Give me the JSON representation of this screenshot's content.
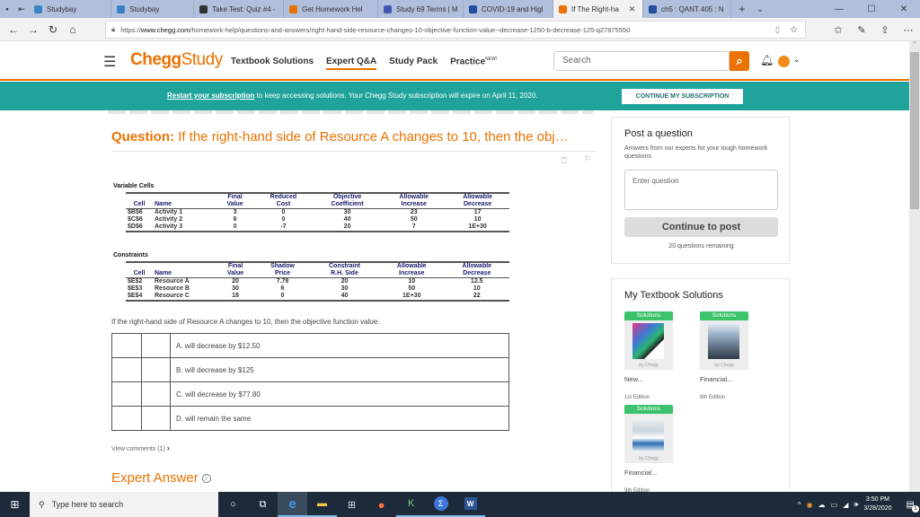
{
  "browser": {
    "tabs": [
      {
        "label": "Studybay",
        "icon": "studybay-icon",
        "color": "#3b82c4",
        "active": false
      },
      {
        "label": "Studybay",
        "icon": "studybay-icon",
        "color": "#3b82c4",
        "active": false
      },
      {
        "label": "Take Test: Quiz #4 -",
        "icon": "blackboard-icon",
        "color": "#333333",
        "active": false
      },
      {
        "label": "Get Homework Hel",
        "icon": "chegg-icon",
        "color": "#eb7100",
        "active": false
      },
      {
        "label": "Study 69 Terms | M",
        "icon": "quizlet-icon",
        "color": "#4257b2",
        "active": false
      },
      {
        "label": "COVID-19 and Higl",
        "icon": "shield-icon",
        "color": "#1f4e9c",
        "active": false
      },
      {
        "label": "If The Right-ha",
        "icon": "chegg-icon",
        "color": "#eb7100",
        "active": true
      },
      {
        "label": "ch5 : QANT 405 : N",
        "icon": "shield-icon",
        "color": "#1f4e9c",
        "active": false
      }
    ],
    "new_tab": "+",
    "tab_menu": "⌄",
    "window_controls": {
      "minimize": "—",
      "maximize": "☐",
      "close": "✕"
    },
    "url_prefix": "https://",
    "url_domain": "www.chegg.com",
    "url_path": "/homework-help/questions-and-answers/right-hand-side-resource-changes-10-objective-function-value--decrease-1250-b-decrease-125-q27875550"
  },
  "header": {
    "logo_bold": "Chegg",
    "logo_light": "Study",
    "nav": [
      {
        "label": "Textbook Solutions",
        "active": false
      },
      {
        "label": "Expert Q&A",
        "active": true
      },
      {
        "label": "Study Pack",
        "active": false
      },
      {
        "label": "Practice",
        "active": false,
        "badge": "NEW!"
      }
    ],
    "search_placeholder": "Search"
  },
  "banner": {
    "link": "Restart your subscription",
    "message": " to keep accessing solutions. Your Chegg Study subscription will expire on April 11, 2020.",
    "cta": "CONTINUE MY SUBSCRIPTION",
    "color": "#20a39b"
  },
  "question": {
    "label": "Question:",
    "title": " If the right-hand side of Resource A changes to 10, then the obj…",
    "variable_cells": {
      "section": "Variable Cells",
      "headers_top": [
        "",
        "",
        "Final",
        "Reduced",
        "Objective",
        "Allowable",
        "Allowable"
      ],
      "headers_bottom": [
        "Cell",
        "Name",
        "Value",
        "Cost",
        "Coefficient",
        "Increase",
        "Decrease"
      ],
      "rows": [
        [
          "$B$6",
          "Activity 1",
          "3",
          "0",
          "30",
          "23",
          "17"
        ],
        [
          "$C$6",
          "Activity 2",
          "6",
          "0",
          "40",
          "50",
          "10"
        ],
        [
          "$D$6",
          "Activity 3",
          "0",
          "-7",
          "20",
          "7",
          "1E+30"
        ]
      ]
    },
    "constraints": {
      "section": "Constraints",
      "headers_top": [
        "",
        "",
        "Final",
        "Shadow",
        "Constraint",
        "Allowable",
        "Allowable"
      ],
      "headers_bottom": [
        "Cell",
        "Name",
        "Value",
        "Price",
        "R.H. Side",
        "Increase",
        "Decrease"
      ],
      "rows": [
        [
          "$E$2",
          "Resource A",
          "20",
          "7.78",
          "20",
          "10",
          "12.5"
        ],
        [
          "$E$3",
          "Resource B",
          "30",
          "6",
          "30",
          "50",
          "10"
        ],
        [
          "$E$4",
          "Resource C",
          "18",
          "0",
          "40",
          "1E+30",
          "22"
        ]
      ]
    },
    "prompt": "If the right-hand side of Resource A changes to 10, then the objective function value:",
    "options": [
      "A. will decrease by $12.50",
      "B. will decrease by $125",
      "C. will decrease by $77.80",
      "D. will remain the same"
    ],
    "comments_link": "View comments (1)",
    "expert_answer": "Expert Answer"
  },
  "post_question": {
    "title": "Post a question",
    "subtitle": "Answers from our experts for your tough homework questions",
    "placeholder": "Enter question",
    "button": "Continue to post",
    "remaining": "20 questions remaining"
  },
  "textbooks": {
    "title": "My Textbook Solutions",
    "books": [
      {
        "badge": "Solutions",
        "title": "New...",
        "edition": "1st Edition",
        "by": "by Chegg"
      },
      {
        "badge": "Solutions",
        "title": "Financial...",
        "edition": "8th Edition",
        "by": "by Chegg"
      },
      {
        "badge": "Solutions",
        "title": "Financial...",
        "edition": "9th Edition",
        "by": "by Chegg"
      }
    ]
  },
  "taskbar": {
    "search_placeholder": "Type here to search",
    "time": "3:50 PM",
    "date": "3/28/2020",
    "notifications": "1"
  }
}
